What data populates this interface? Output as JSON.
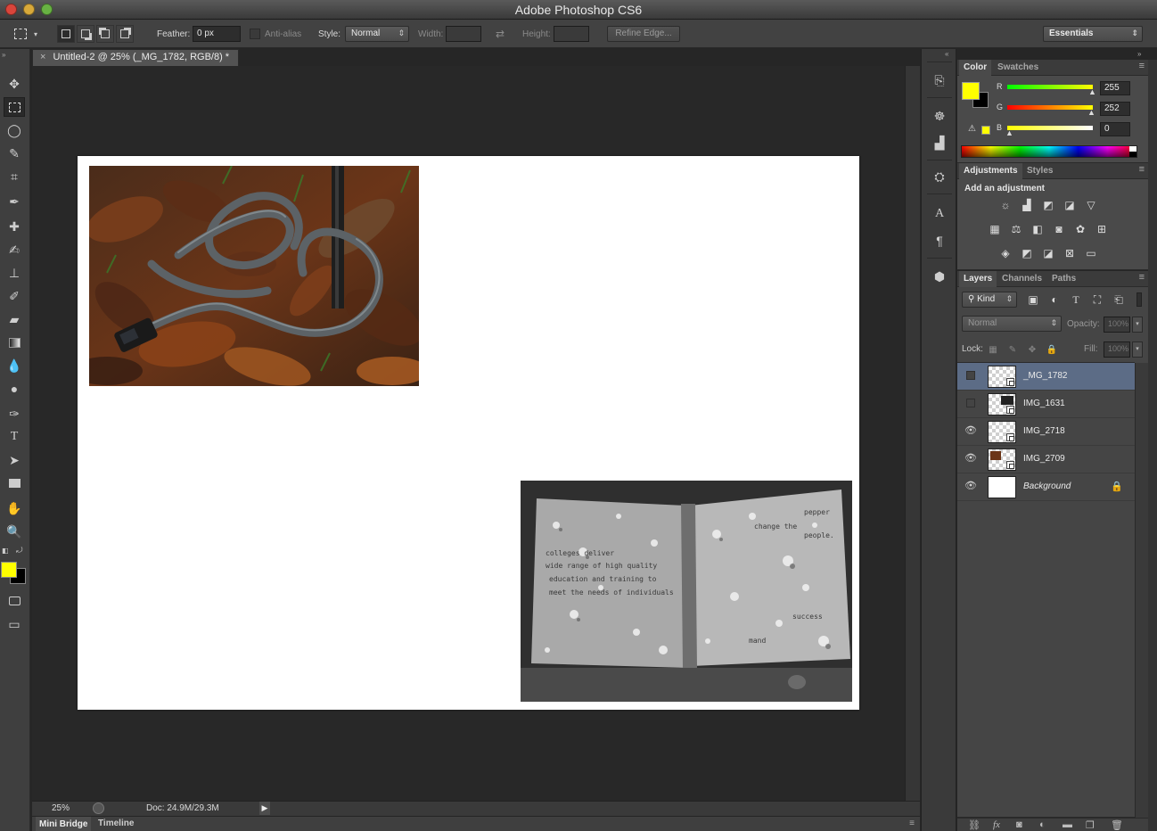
{
  "app": {
    "title": "Adobe Photoshop CS6"
  },
  "options_bar": {
    "feather_label": "Feather:",
    "feather_value": "0 px",
    "anti_alias_label": "Anti-alias",
    "style_label": "Style:",
    "style_value": "Normal",
    "width_label": "Width:",
    "height_label": "Height:",
    "refine_edge_label": "Refine Edge...",
    "workspace_value": "Essentials"
  },
  "document": {
    "tab_title": "Untitled-2 @ 25% (_MG_1782, RGB/8) *",
    "zoom": "25%",
    "doc_info": "Doc: 24.9M/29.3M",
    "book_text": [
      "pepper",
      "change the",
      "people.",
      "colleges deliver",
      "wide range of high quality",
      "education and training to",
      "meet the needs of individuals",
      "success",
      "mand"
    ]
  },
  "bottom_tabs": [
    "Mini Bridge",
    "Timeline"
  ],
  "color_panel": {
    "tabs": [
      "Color",
      "Swatches"
    ],
    "foreground": "#ffff00",
    "background": "#000000",
    "r_label": "R",
    "g_label": "G",
    "b_label": "B",
    "r": 255,
    "g": 252,
    "b": 0,
    "r_value": "255",
    "g_value": "252",
    "b_value": "0"
  },
  "adjustments_panel": {
    "tabs": [
      "Adjustments",
      "Styles"
    ],
    "heading": "Add an adjustment"
  },
  "layers_panel": {
    "tabs": [
      "Layers",
      "Channels",
      "Paths"
    ],
    "kind_label": "Kind",
    "blend_mode": "Normal",
    "opacity_label": "Opacity:",
    "opacity_value": "100%",
    "lock_label": "Lock:",
    "fill_label": "Fill:",
    "fill_value": "100%",
    "layers": [
      {
        "name": "_MG_1782",
        "visible": false,
        "selected": true
      },
      {
        "name": "IMG_1631",
        "visible": false,
        "selected": false
      },
      {
        "name": "IMG_2718",
        "visible": true,
        "selected": false
      },
      {
        "name": "IMG_2709",
        "visible": true,
        "selected": false
      },
      {
        "name": "Background",
        "visible": true,
        "selected": false,
        "locked": true
      }
    ]
  },
  "icons": {
    "eye": "👁",
    "lock": "🔒"
  }
}
